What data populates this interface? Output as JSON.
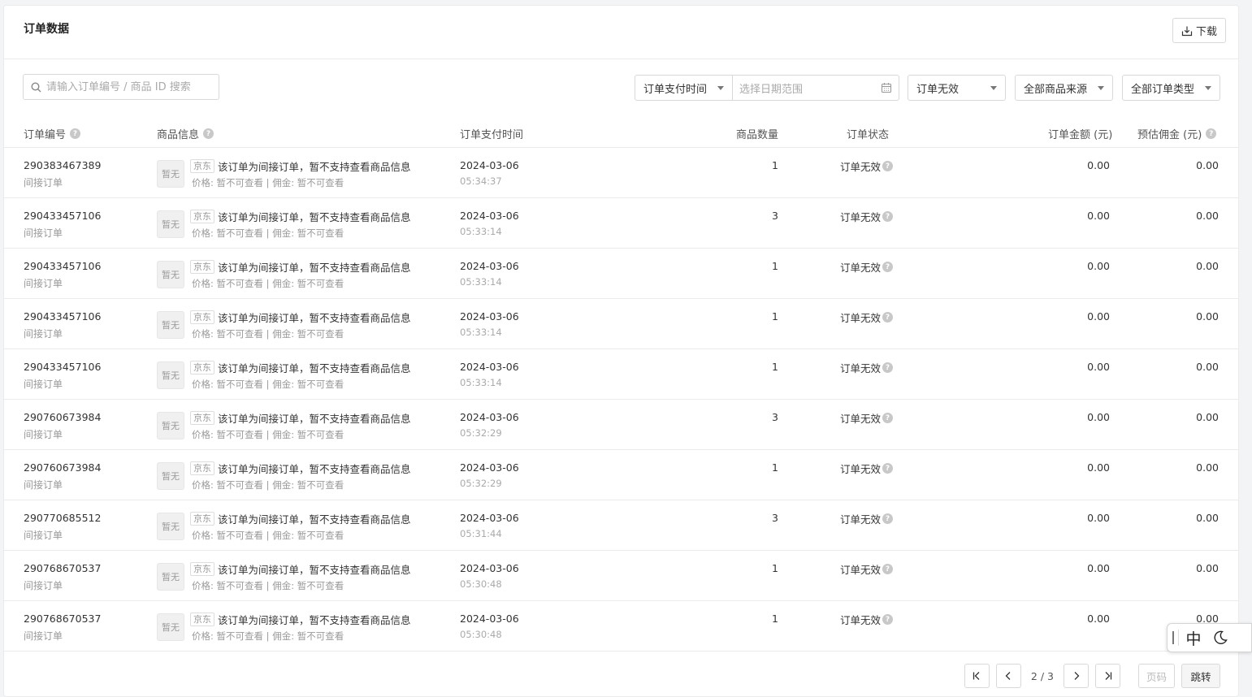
{
  "header": {
    "title": "订单数据",
    "download_label": "下载"
  },
  "filters": {
    "search_placeholder": "请输入订单编号 / 商品 ID 搜索",
    "date_type": "订单支付时间",
    "date_range_placeholder": "选择日期范围",
    "status": "订单无效",
    "source": "全部商品来源",
    "order_type": "全部订单类型"
  },
  "columns": {
    "order_no": "订单编号",
    "goods": "商品信息",
    "pay_time": "订单支付时间",
    "qty": "商品数量",
    "status": "订单状态",
    "amount": "订单金额 (元)",
    "commission": "预估佣金 (元)"
  },
  "rows": [
    {
      "order_no": "290383467389",
      "order_type": "间接订单",
      "thumb": "暂无",
      "tag": "京东",
      "goods_title": "该订单为间接订单，暂不支持查看商品信息",
      "goods_sub": "价格: 暂不可查看 | 佣金: 暂不可查看",
      "date": "2024-03-06",
      "time": "05:34:37",
      "qty": "1",
      "status": "订单无效",
      "amount": "0.00",
      "commission": "0.00"
    },
    {
      "order_no": "290433457106",
      "order_type": "间接订单",
      "thumb": "暂无",
      "tag": "京东",
      "goods_title": "该订单为间接订单，暂不支持查看商品信息",
      "goods_sub": "价格: 暂不可查看 | 佣金: 暂不可查看",
      "date": "2024-03-06",
      "time": "05:33:14",
      "qty": "3",
      "status": "订单无效",
      "amount": "0.00",
      "commission": "0.00"
    },
    {
      "order_no": "290433457106",
      "order_type": "间接订单",
      "thumb": "暂无",
      "tag": "京东",
      "goods_title": "该订单为间接订单，暂不支持查看商品信息",
      "goods_sub": "价格: 暂不可查看 | 佣金: 暂不可查看",
      "date": "2024-03-06",
      "time": "05:33:14",
      "qty": "1",
      "status": "订单无效",
      "amount": "0.00",
      "commission": "0.00"
    },
    {
      "order_no": "290433457106",
      "order_type": "间接订单",
      "thumb": "暂无",
      "tag": "京东",
      "goods_title": "该订单为间接订单，暂不支持查看商品信息",
      "goods_sub": "价格: 暂不可查看 | 佣金: 暂不可查看",
      "date": "2024-03-06",
      "time": "05:33:14",
      "qty": "1",
      "status": "订单无效",
      "amount": "0.00",
      "commission": "0.00"
    },
    {
      "order_no": "290433457106",
      "order_type": "间接订单",
      "thumb": "暂无",
      "tag": "京东",
      "goods_title": "该订单为间接订单，暂不支持查看商品信息",
      "goods_sub": "价格: 暂不可查看 | 佣金: 暂不可查看",
      "date": "2024-03-06",
      "time": "05:33:14",
      "qty": "1",
      "status": "订单无效",
      "amount": "0.00",
      "commission": "0.00"
    },
    {
      "order_no": "290760673984",
      "order_type": "间接订单",
      "thumb": "暂无",
      "tag": "京东",
      "goods_title": "该订单为间接订单，暂不支持查看商品信息",
      "goods_sub": "价格: 暂不可查看 | 佣金: 暂不可查看",
      "date": "2024-03-06",
      "time": "05:32:29",
      "qty": "3",
      "status": "订单无效",
      "amount": "0.00",
      "commission": "0.00"
    },
    {
      "order_no": "290760673984",
      "order_type": "间接订单",
      "thumb": "暂无",
      "tag": "京东",
      "goods_title": "该订单为间接订单，暂不支持查看商品信息",
      "goods_sub": "价格: 暂不可查看 | 佣金: 暂不可查看",
      "date": "2024-03-06",
      "time": "05:32:29",
      "qty": "1",
      "status": "订单无效",
      "amount": "0.00",
      "commission": "0.00"
    },
    {
      "order_no": "290770685512",
      "order_type": "间接订单",
      "thumb": "暂无",
      "tag": "京东",
      "goods_title": "该订单为间接订单，暂不支持查看商品信息",
      "goods_sub": "价格: 暂不可查看 | 佣金: 暂不可查看",
      "date": "2024-03-06",
      "time": "05:31:44",
      "qty": "3",
      "status": "订单无效",
      "amount": "0.00",
      "commission": "0.00"
    },
    {
      "order_no": "290768670537",
      "order_type": "间接订单",
      "thumb": "暂无",
      "tag": "京东",
      "goods_title": "该订单为间接订单，暂不支持查看商品信息",
      "goods_sub": "价格: 暂不可查看 | 佣金: 暂不可查看",
      "date": "2024-03-06",
      "time": "05:30:48",
      "qty": "1",
      "status": "订单无效",
      "amount": "0.00",
      "commission": "0.00"
    },
    {
      "order_no": "290768670537",
      "order_type": "间接订单",
      "thumb": "暂无",
      "tag": "京东",
      "goods_title": "该订单为间接订单，暂不支持查看商品信息",
      "goods_sub": "价格: 暂不可查看 | 佣金: 暂不可查看",
      "date": "2024-03-06",
      "time": "05:30:48",
      "qty": "1",
      "status": "订单无效",
      "amount": "0.00",
      "commission": "0.00"
    }
  ],
  "pagination": {
    "info": "2 / 3",
    "page_input_placeholder": "页码",
    "jump_label": "跳转"
  },
  "ime": {
    "lang": "中"
  }
}
